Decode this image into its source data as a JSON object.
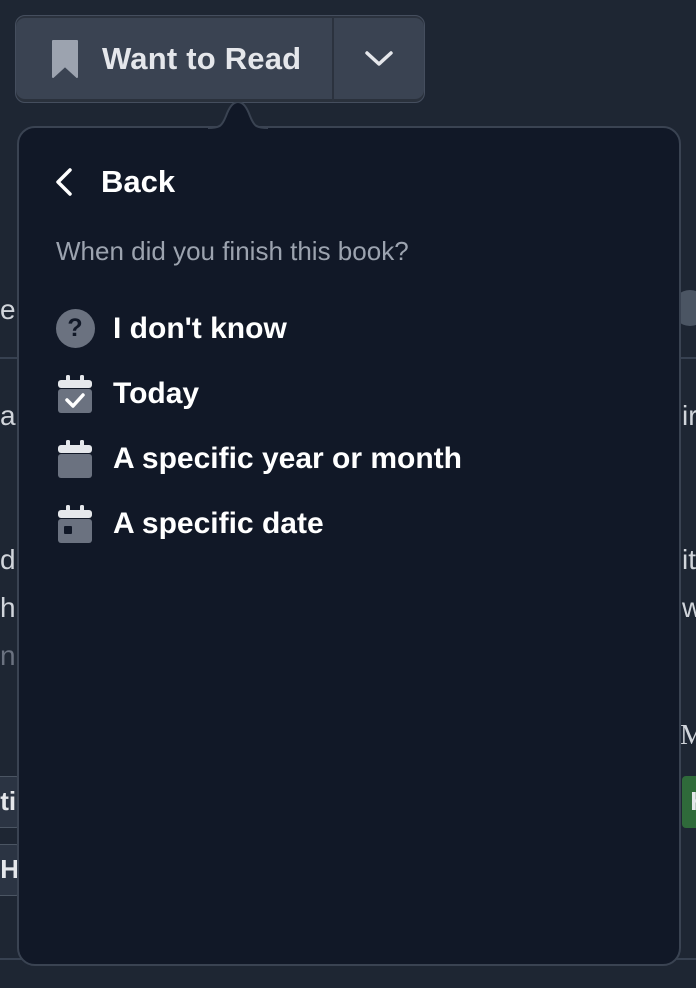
{
  "shelf_button": {
    "label": "Want to Read",
    "icon": "bookmark-icon",
    "toggle_icon": "chevron-down-icon"
  },
  "popover": {
    "back_label": "Back",
    "prompt": "When did you finish this book?",
    "options": [
      {
        "label": "I don't know",
        "icon": "question-circle-icon"
      },
      {
        "label": "Today",
        "icon": "calendar-check-icon"
      },
      {
        "label": "A specific year or month",
        "icon": "calendar-icon"
      },
      {
        "label": "A specific date",
        "icon": "calendar-day-icon"
      }
    ]
  },
  "colors": {
    "popover_bg": "#111827",
    "page_bg": "#1e2633",
    "button_bg": "#3a4352",
    "icon_gray": "#6b7280",
    "muted_text": "#9ca3af",
    "green_badge": "#2f6a3a"
  }
}
